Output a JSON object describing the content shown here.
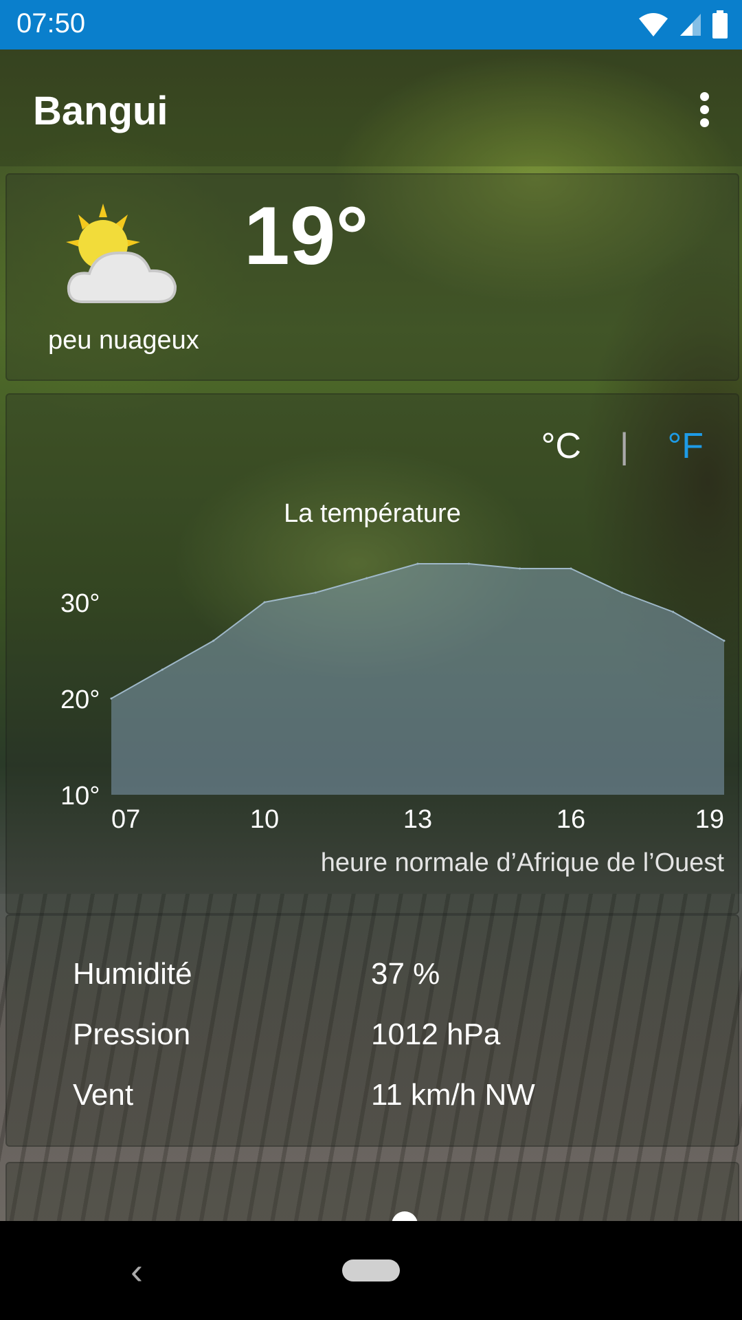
{
  "status_bar": {
    "time": "07:50"
  },
  "app_bar": {
    "title": "Bangui"
  },
  "current": {
    "temperature": "19°",
    "condition": "peu nuageux",
    "icon": "partly-cloudy-icon"
  },
  "units": {
    "celsius": "°C",
    "separator": "|",
    "fahrenheit": "°F",
    "active": "°F"
  },
  "chart_data": {
    "type": "area",
    "title": "La température",
    "x": [
      "07",
      "10",
      "13",
      "16",
      "19"
    ],
    "x_values": [
      7,
      8,
      9,
      10,
      11,
      12,
      13,
      14,
      15,
      16,
      17,
      18,
      19
    ],
    "y_values": [
      20,
      23,
      26,
      30,
      31,
      32.5,
      34,
      34,
      33.5,
      33.5,
      31,
      29,
      26
    ],
    "y_ticks": [
      "10°",
      "20°",
      "30°"
    ],
    "ylim": [
      10,
      35
    ],
    "xlabel": "heure normale d’Afrique de l’Ouest",
    "colors": {
      "fill": "#7f9bb0",
      "stroke": "#9fb8c8"
    }
  },
  "details": [
    {
      "label": "Humidité",
      "value": "37 %"
    },
    {
      "label": "Pression",
      "value": "1012 hPa"
    },
    {
      "label": "Vent",
      "value": "11 km/h NW"
    }
  ]
}
